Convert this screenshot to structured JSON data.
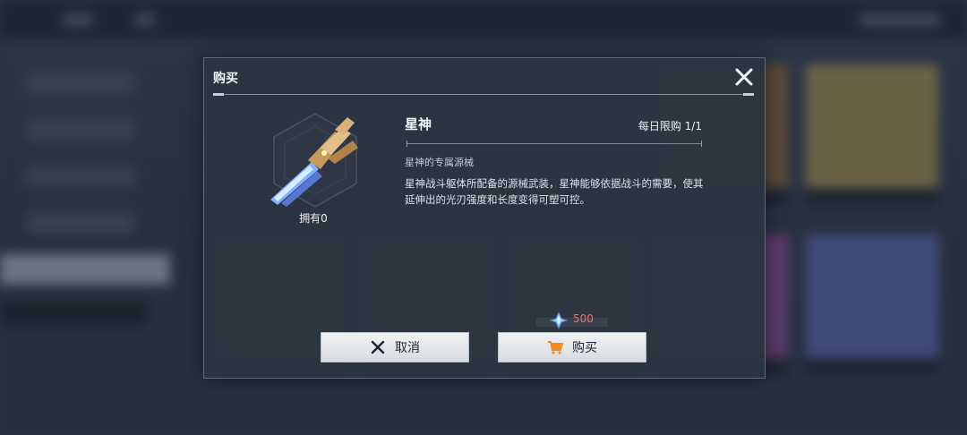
{
  "dialog": {
    "title": "购买",
    "item": {
      "name": "星神",
      "owned": "拥有0",
      "limit": "每日限购 1/1",
      "subtitle": "星神的专属源械",
      "description": "星神战斗躯体所配备的源械武装，星神能够依据战斗的需要，使其延伸出的光刃强度和长度变得可塑可控。"
    },
    "price": {
      "currency_icon": "star-crystal-icon",
      "value": "500",
      "color": "#ff6b5e"
    },
    "buttons": {
      "cancel_label": "取消",
      "cancel_icon": "close-icon",
      "buy_label": "购买",
      "buy_icon": "cart-icon",
      "buy_icon_color": "#f08a1c"
    }
  }
}
